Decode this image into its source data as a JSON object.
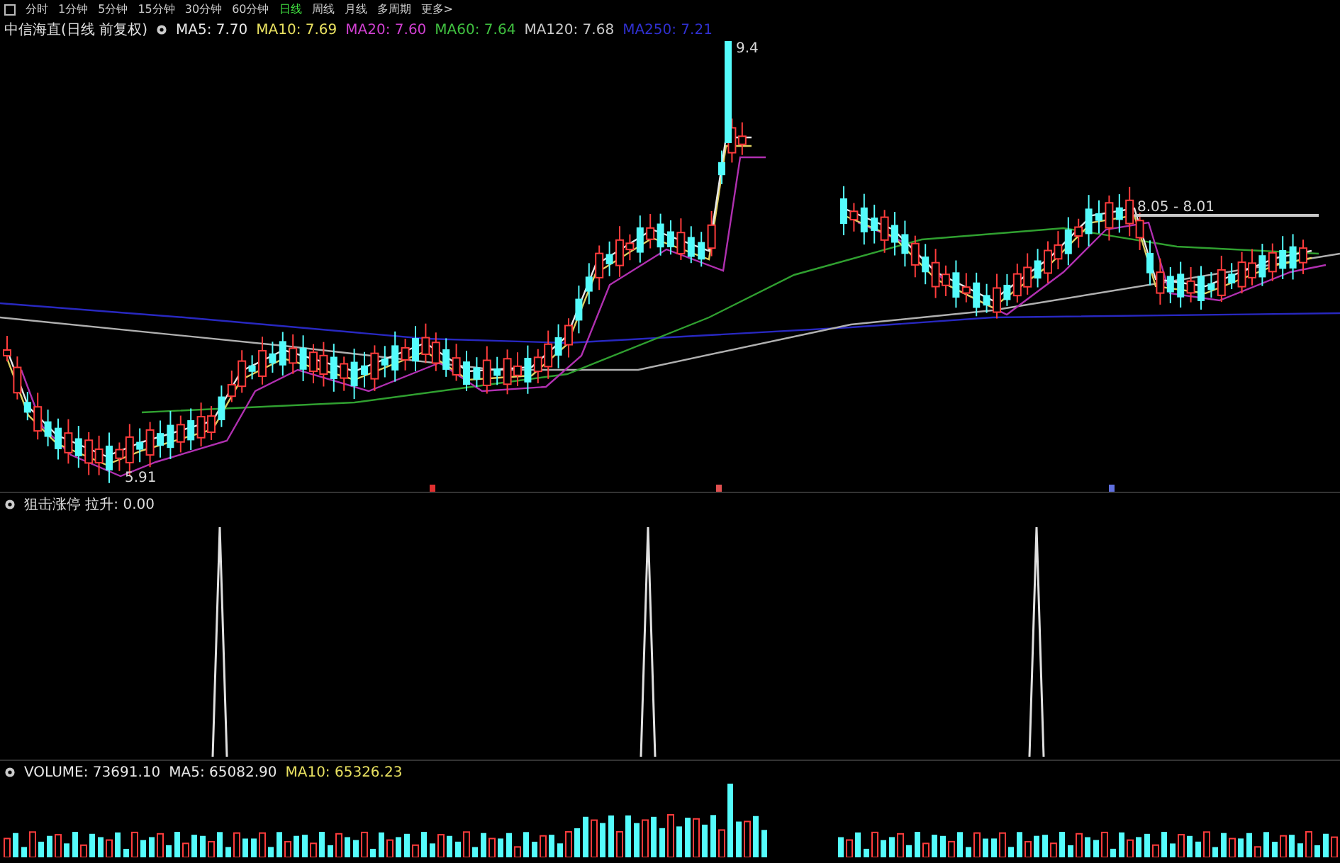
{
  "period_tabs": [
    {
      "label": "分时",
      "selected": false
    },
    {
      "label": "1分钟",
      "selected": false
    },
    {
      "label": "5分钟",
      "selected": false
    },
    {
      "label": "15分钟",
      "selected": false
    },
    {
      "label": "30分钟",
      "selected": false
    },
    {
      "label": "60分钟",
      "selected": false
    },
    {
      "label": "日线",
      "selected": true
    },
    {
      "label": "周线",
      "selected": false
    },
    {
      "label": "月线",
      "selected": false
    },
    {
      "label": "多周期",
      "selected": false
    },
    {
      "label": "更多>",
      "selected": false
    }
  ],
  "price_chart": {
    "title": "中信海直(日线 前复权)",
    "moving_averages": [
      {
        "label": "MA5: 7.70",
        "color": "#e8e8e8"
      },
      {
        "label": "MA10: 7.69",
        "color": "#e8e060"
      },
      {
        "label": "MA20: 7.60",
        "color": "#d040d0"
      },
      {
        "label": "MA60: 7.64",
        "color": "#40c040"
      },
      {
        "label": "MA120: 7.68",
        "color": "#c8c8c8"
      },
      {
        "label": "MA250: 7.21",
        "color": "#3030d0"
      }
    ],
    "high_label": "9.4",
    "low_label": "5.91",
    "range_label": "8.05 - 8.01"
  },
  "indicator_panel": {
    "title": "狙击涨停 拉升: 0.00"
  },
  "volume_panel": {
    "items": [
      {
        "label": "VOLUME: 73691.10",
        "color": "#e8e8e8"
      },
      {
        "label": "MA5: 65082.90",
        "color": "#e8e8e8"
      },
      {
        "label": "MA10: 65326.23",
        "color": "#e8e060"
      }
    ]
  }
}
